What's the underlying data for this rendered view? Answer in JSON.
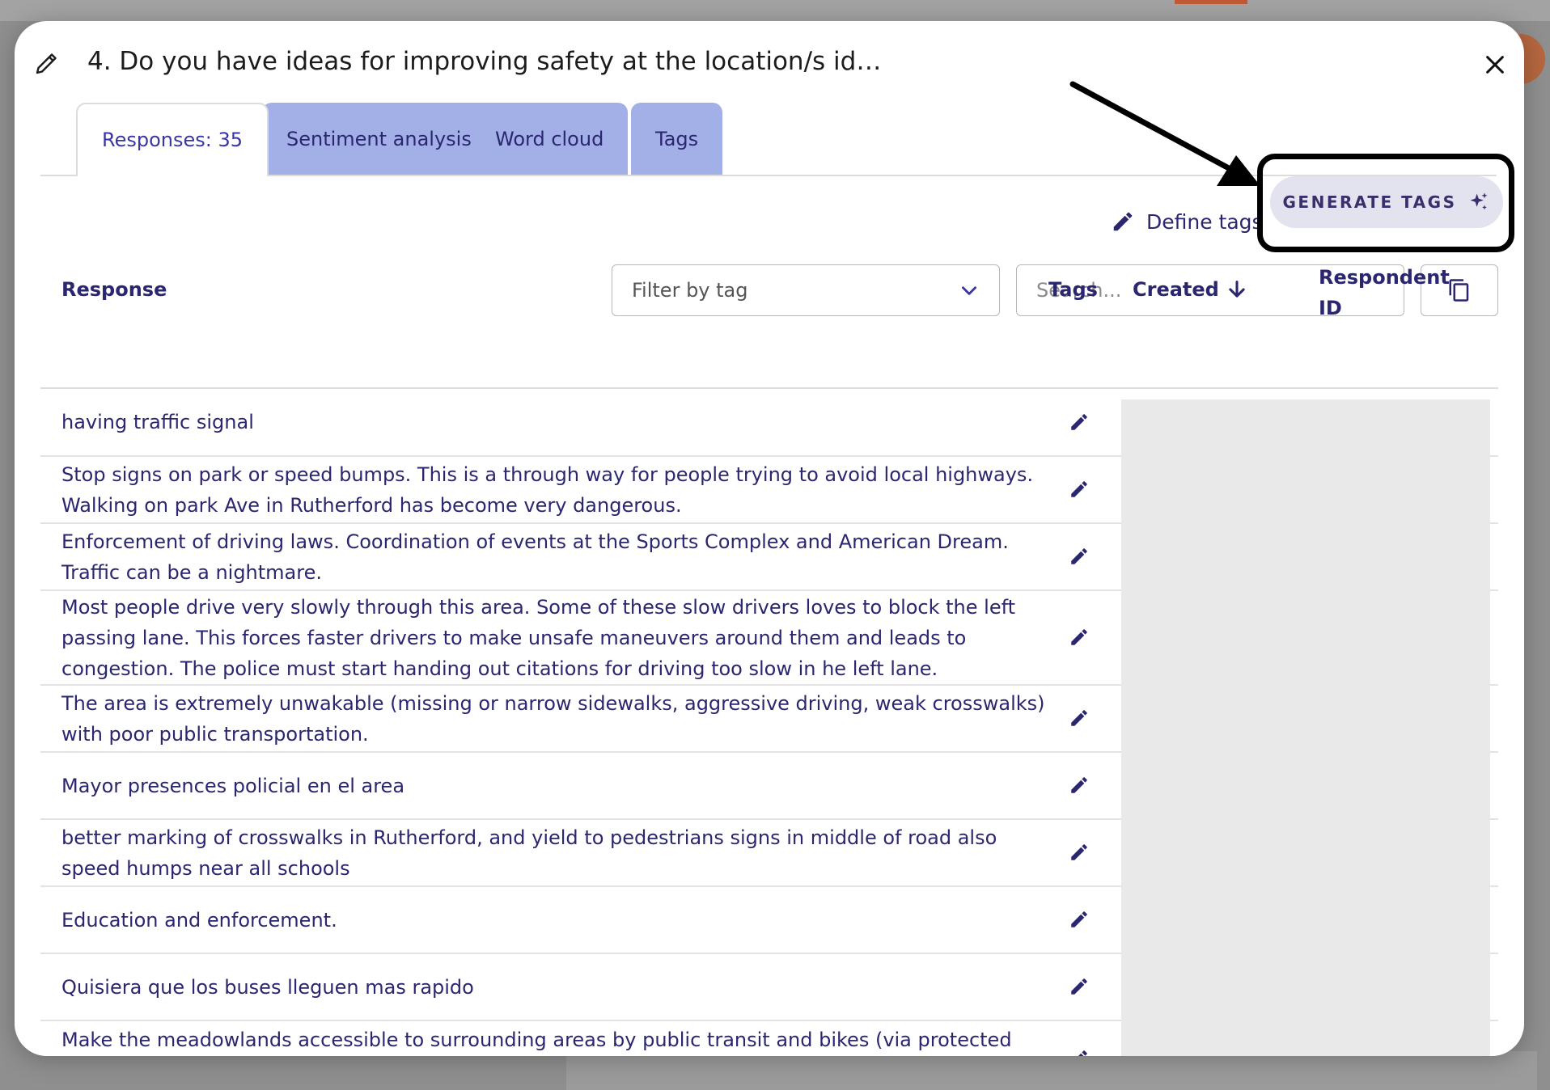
{
  "modal": {
    "title": "4. Do you have ideas for improving safety at the location/s id…",
    "close_icon": "close-icon",
    "title_edit_icon": "pencil-outline-icon"
  },
  "tabs": [
    {
      "label": "Responses: 35",
      "active": true
    },
    {
      "label": "Sentiment analysis",
      "active": false
    },
    {
      "label": "Word cloud",
      "active": false
    },
    {
      "label": "Tags",
      "active": false
    }
  ],
  "toolbar": {
    "define_tags_label": "Define tags",
    "generate_tags_label": "GENERATE TAGS",
    "generate_icon": "sparkle-icon"
  },
  "filters": {
    "filter_placeholder": "Filter by tag",
    "search_placeholder": "Search...",
    "copy_icon": "copy-icon"
  },
  "table": {
    "headers": {
      "response": "Response",
      "tags": "Tags",
      "created": "Created",
      "respondent_id": "Respondent ID"
    },
    "rows": [
      {
        "response": "having traffic signal"
      },
      {
        "response": "Stop signs on park or speed bumps. This is a through way for people trying to avoid local highways. Walking on park Ave in Rutherford has become very dangerous."
      },
      {
        "response": "Enforcement of driving laws. Coordination of events at the Sports Complex and American Dream. Traffic can be a nightmare."
      },
      {
        "response": "Most people drive very slowly through this area. Some of these slow drivers loves to block the left passing lane. This forces faster drivers to make unsafe maneuvers around them and leads to congestion. The police must start handing out citations for driving too slow in he left lane."
      },
      {
        "response": "The area is extremely unwakable (missing or narrow sidewalks, aggressive driving, weak crosswalks) with poor public transportation."
      },
      {
        "response": "Mayor presences policial en el area"
      },
      {
        "response": "better marking of crosswalks in Rutherford, and yield to pedestrians signs in middle of road also speed humps near all schools"
      },
      {
        "response": "Education and enforcement."
      },
      {
        "response": "Quisiera que los buses lleguen mas rapido"
      },
      {
        "response": "Make the meadowlands accessible to surrounding areas by public transit and bikes (via protected"
      }
    ]
  },
  "colors": {
    "text_primary": "#2b2670",
    "tab_inactive": "#a3b0e8",
    "generate_bg": "#e3e3ef",
    "annotation": "#000000"
  }
}
